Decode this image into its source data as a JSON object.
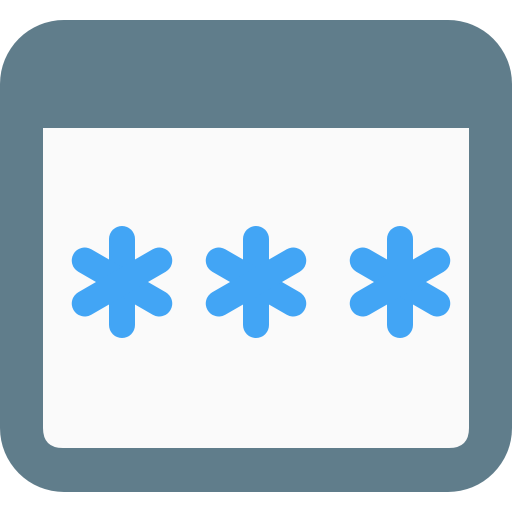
{
  "icon": {
    "name": "password-window-icon",
    "frame_color": "#607D8B",
    "panel_color": "#FAFAFA",
    "asterisk_color": "#42A5F5",
    "asterisk_count": 3
  }
}
